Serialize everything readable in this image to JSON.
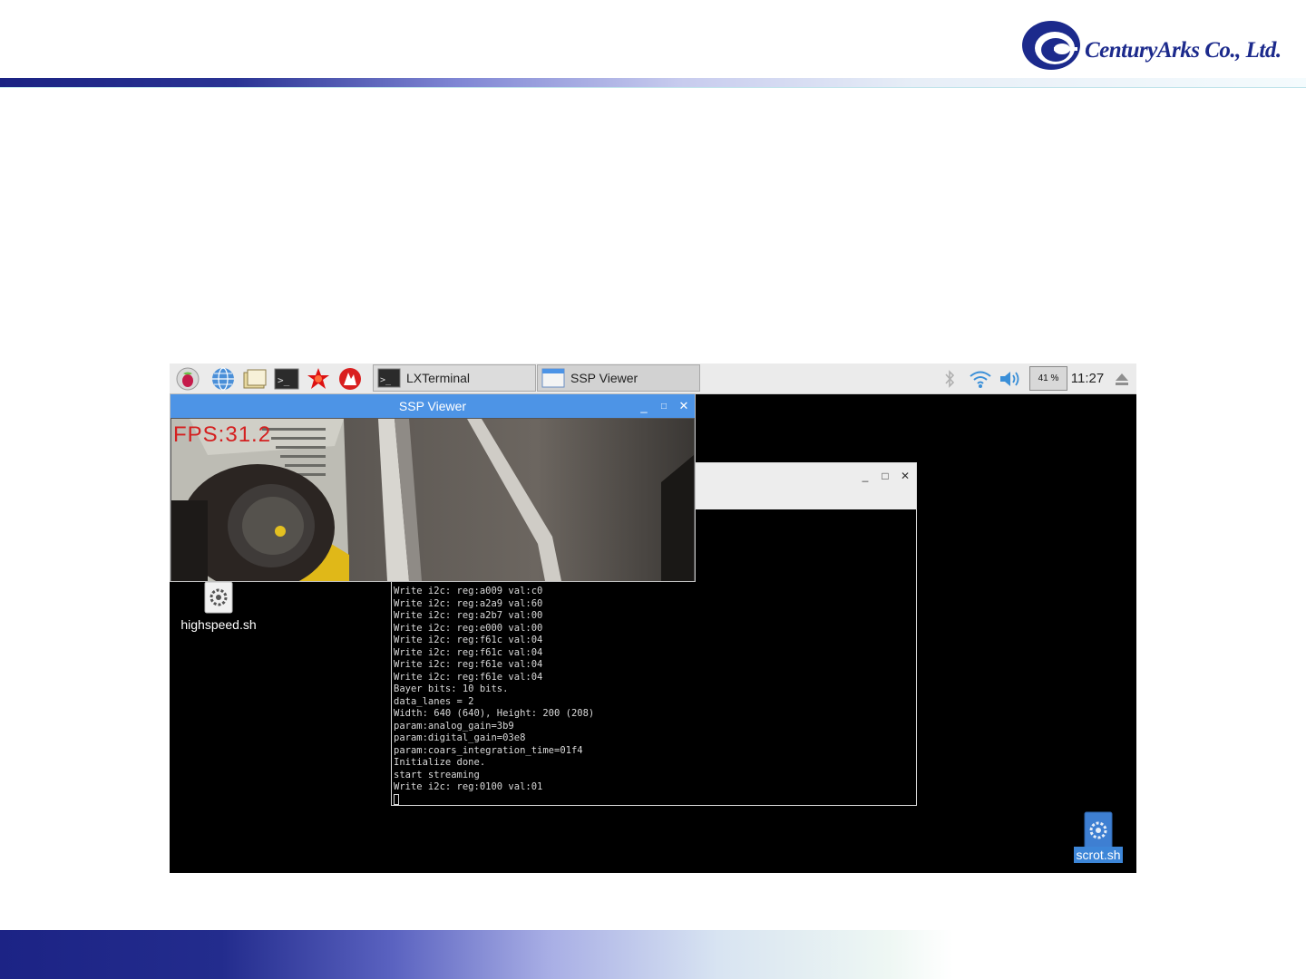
{
  "company": {
    "name": "CenturyArks Co., Ltd."
  },
  "taskbar": {
    "launchers": [
      "raspberry-menu-icon",
      "web-browser-icon",
      "file-manager-icon",
      "terminal-icon",
      "mathematica-icon",
      "wolfram-icon"
    ],
    "windows": [
      {
        "label": "LXTerminal",
        "icon": "terminal-icon"
      },
      {
        "label": "SSP Viewer",
        "icon": "window-icon"
      }
    ],
    "tray": {
      "cpu": "41 %",
      "clock": "11:27"
    }
  },
  "ssp_viewer": {
    "title": "SSP Viewer",
    "fps": "FPS:31.2",
    "controls": {
      "minimize": "_",
      "maximize": "□",
      "close": "✕"
    }
  },
  "terminal": {
    "controls": {
      "minimize": "_",
      "maximize": "□",
      "close": "✕"
    },
    "lines": [
      "Write i2c: reg:a009 val:c0",
      "Write i2c: reg:a2a9 val:60",
      "Write i2c: reg:a2b7 val:00",
      "Write i2c: reg:e000 val:00",
      "Write i2c: reg:f61c val:04",
      "Write i2c: reg:f61c val:04",
      "Write i2c: reg:f61e val:04",
      "Write i2c: reg:f61e val:04",
      "Bayer bits: 10 bits.",
      "data_lanes = 2",
      "Width: 640 (640), Height: 200 (208)",
      "param:analog_gain=3b9",
      "param:digital_gain=03e8",
      "param:coars_integration_time=01f4",
      "Initialize done.",
      "start streaming",
      "Write i2c: reg:0100 val:01"
    ]
  },
  "desktop_icons": [
    {
      "name": "highspeed.sh"
    },
    {
      "name": "scrot.sh"
    }
  ]
}
